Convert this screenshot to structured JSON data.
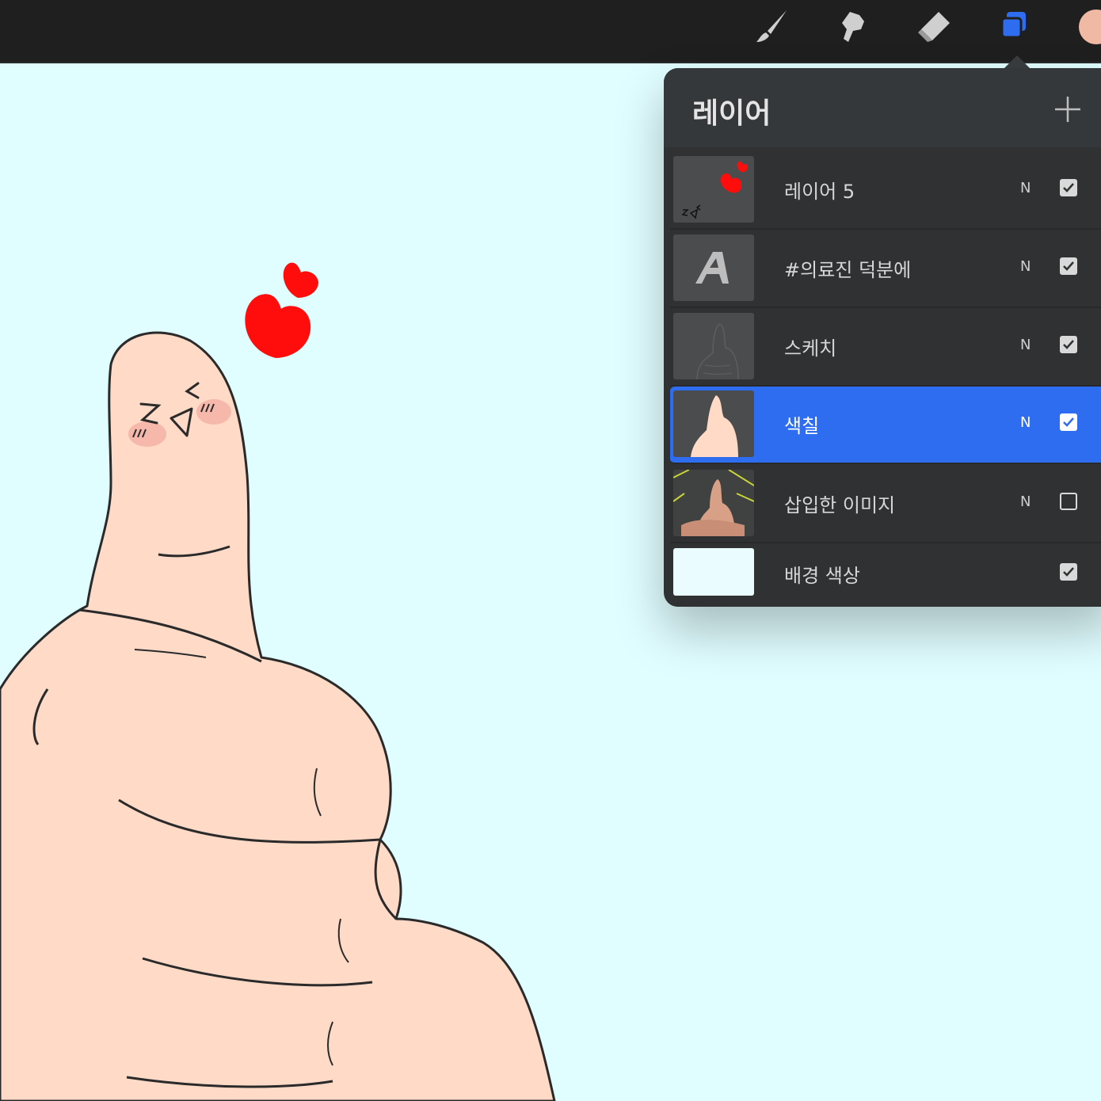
{
  "toolbar": {
    "tools": [
      {
        "name": "brush",
        "icon": "brush-icon"
      },
      {
        "name": "smudge",
        "icon": "smudge-icon"
      },
      {
        "name": "eraser",
        "icon": "eraser-icon"
      },
      {
        "name": "layers",
        "icon": "layers-icon",
        "active": true
      }
    ],
    "current_color": "#f0b9a4",
    "accent": "#2f6df0"
  },
  "canvas": {
    "background": "#e0fdff",
    "drawing": "thumbs-up hand with heart",
    "text_marks": {
      "z": "Z",
      "left_eye": "V",
      "eyebrow": "<"
    }
  },
  "layers_panel": {
    "title": "레이어",
    "add_icon": "plus-icon",
    "layers": [
      {
        "name": "레이어 5",
        "blend": "N",
        "visible": true,
        "selected": false,
        "thumb": "heart-sketch"
      },
      {
        "name": "#의료진 덕분에",
        "blend": "N",
        "visible": true,
        "selected": false,
        "thumb": "text-A"
      },
      {
        "name": "스케치",
        "blend": "N",
        "visible": true,
        "selected": false,
        "thumb": "sketch"
      },
      {
        "name": "색칠",
        "blend": "N",
        "visible": true,
        "selected": true,
        "thumb": "fill-hand"
      },
      {
        "name": "삽입한 이미지",
        "blend": "N",
        "visible": false,
        "selected": false,
        "thumb": "photo"
      },
      {
        "name": "배경 색상",
        "blend": "",
        "visible": true,
        "selected": false,
        "thumb": "background-color"
      }
    ]
  }
}
